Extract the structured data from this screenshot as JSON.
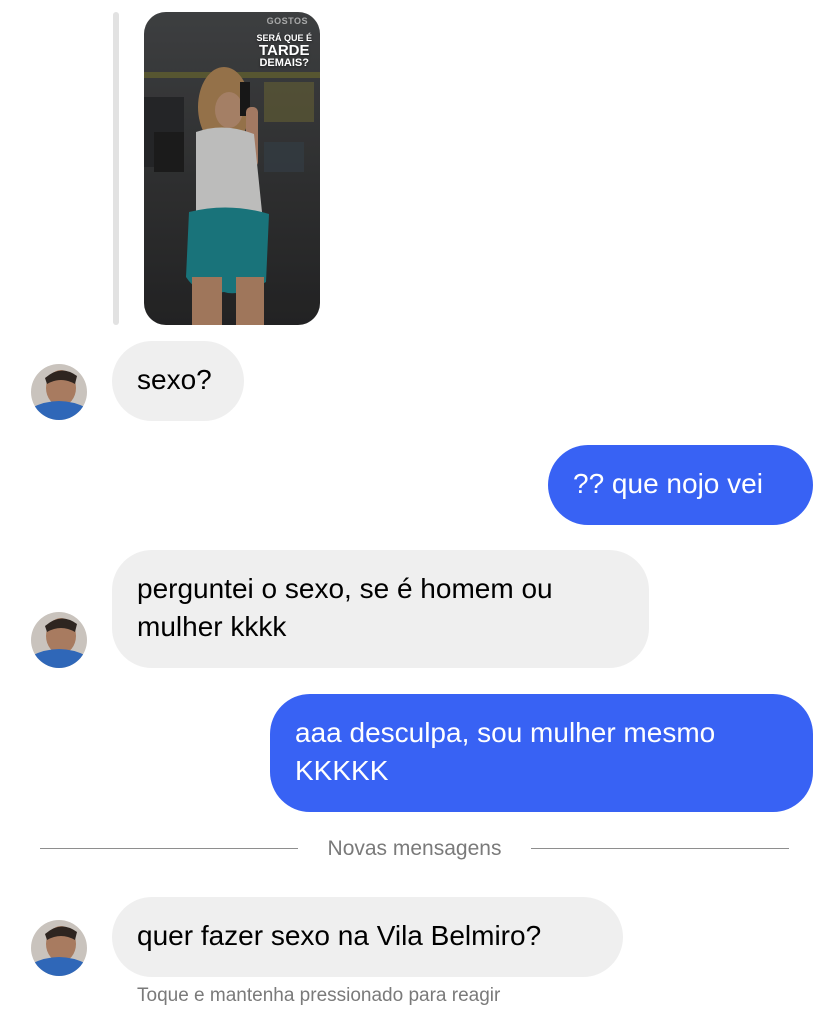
{
  "story": {
    "brand": "GOSTOS",
    "caption_line1": "SERÁ QUE É",
    "caption_line2": "TARDE",
    "caption_line3": "DEMAIS?"
  },
  "messages": [
    {
      "direction": "incoming",
      "text": "sexo?"
    },
    {
      "direction": "outgoing",
      "text": "?? que nojo vei"
    },
    {
      "direction": "incoming",
      "text": "perguntei o sexo, se é homem ou mulher kkkk"
    },
    {
      "direction": "outgoing",
      "text": "aaa desculpa, sou mulher mesmo KKKKK"
    },
    {
      "direction": "incoming",
      "text": "quer fazer sexo na Vila Belmiro?"
    }
  ],
  "divider_label": "Novas mensagens",
  "hint": "Toque e mantenha pressionado para reagir",
  "colors": {
    "incoming_bubble": "#efefef",
    "outgoing_bubble": "#3862f4",
    "outgoing_text": "#ffffff"
  }
}
